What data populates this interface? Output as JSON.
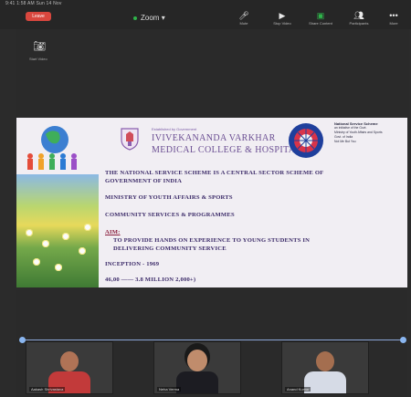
{
  "window": {
    "status_text": "9:41   1:58 AM   Sun 14 Nov",
    "leave_label": "Leave",
    "app_title": "Zoom"
  },
  "toolbar": {
    "items": [
      {
        "label": "Mute",
        "icon": "microphone-icon"
      },
      {
        "label": "Stop Video",
        "icon": "video-camera-icon"
      },
      {
        "label": "Share Content",
        "icon": "share-screen-icon"
      },
      {
        "label": "Participants",
        "icon": "participants-icon"
      },
      {
        "label": "More",
        "icon": "more-icon"
      }
    ]
  },
  "camera_off": {
    "label": "Start Video",
    "icon": "camera-switch-icon"
  },
  "slide": {
    "college_sub": "Established by Government",
    "college_name_line1": "IVIVEKANANDA VARKHAR",
    "college_name_line2": "MEDICAL COLLEGE & HOSPITALS",
    "nss_side_title": "National Service Scheme",
    "nss_side_lines": [
      "an initiative of the Govt.",
      "Ministry of Youth Affairs and Sports",
      "Govt. of India",
      "Not Me But You"
    ],
    "lines": [
      {
        "text": "THE NATIONAL SERVICE SCHEME IS A CENTRAL SECTOR SCHEME OF",
        "kind": "normal"
      },
      {
        "text": "GOVERNMENT OF INDIA",
        "kind": "normal"
      },
      {
        "text": "MINISTRY OF YOUTH AFFAIRS & SPORTS",
        "kind": "normal"
      },
      {
        "text": "COMMUNITY SERVICES & PROGRAMMES",
        "kind": "normal"
      },
      {
        "text": "AIM:",
        "kind": "aim"
      },
      {
        "text": "TO PROVIDE HANDS ON EXPERIENCE TO YOUNG STUDENTS IN",
        "kind": "indent"
      },
      {
        "text": "DELIVERING COMMUNITY SERVICE",
        "kind": "indent"
      },
      {
        "text": "INCEPTION - 1969",
        "kind": "normal"
      },
      {
        "text": "46,00 —— 3.8 MILLION 2,000+)",
        "kind": "normal"
      }
    ]
  },
  "participants": [
    {
      "name": "Aakash Shrivastava",
      "shirt": "#c23a3a",
      "skin": "#b07356"
    },
    {
      "name": "Neha Verma",
      "shirt": "#1c1c22",
      "skin": "#c08c6c"
    },
    {
      "name": "Anand Kumar",
      "shirt": "#d6dbe6",
      "skin": "#a46e4f"
    }
  ],
  "colors": {
    "leave": "#d9473e",
    "accent_green": "#2fb34a",
    "slide_text": "#3b2a68",
    "aim_text": "#8a1e3c",
    "college_purple": "#6a4d92"
  }
}
